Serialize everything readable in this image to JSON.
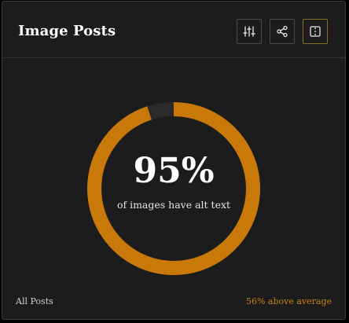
{
  "card": {
    "title": "Image Posts",
    "actions": [
      {
        "name": "filter-settings-icon"
      },
      {
        "name": "share-icon"
      },
      {
        "name": "split-view-icon"
      }
    ]
  },
  "gauge": {
    "value_text": "95%",
    "value": 0.95,
    "caption": "of images have alt text",
    "colors": {
      "fill": "#c9780a",
      "track": "#2a2a2a"
    }
  },
  "footer": {
    "left": "All Posts",
    "right": "56% above average"
  }
}
